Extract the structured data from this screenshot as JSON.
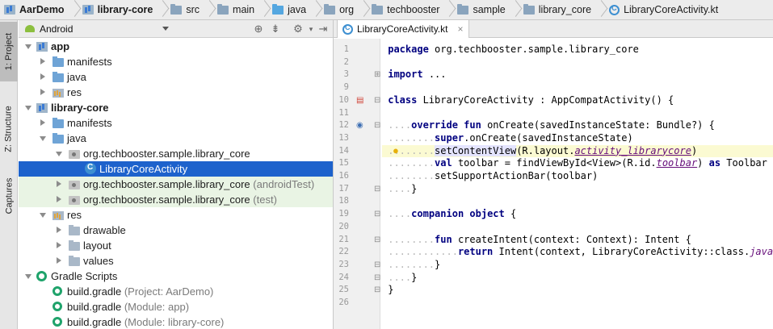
{
  "breadcrumbs": [
    {
      "label": "AarDemo",
      "icon": "module-icon",
      "bold": true
    },
    {
      "label": "library-core",
      "icon": "module-icon",
      "bold": true
    },
    {
      "label": "src",
      "icon": "folder-icon"
    },
    {
      "label": "main",
      "icon": "folder-icon"
    },
    {
      "label": "java",
      "icon": "folder-icon"
    },
    {
      "label": "org",
      "icon": "folder-icon"
    },
    {
      "label": "techbooster",
      "icon": "folder-icon"
    },
    {
      "label": "sample",
      "icon": "folder-icon"
    },
    {
      "label": "library_core",
      "icon": "folder-icon"
    },
    {
      "label": "LibraryCoreActivity.kt",
      "icon": "kotlin-class-icon"
    }
  ],
  "tool_strip": {
    "project_tab": "1: Project",
    "structure_tab": "Z: Structure",
    "captures_tab": "Captures"
  },
  "project_panel": {
    "view_mode": "Android",
    "tree": [
      {
        "label": "app",
        "bold": true
      },
      {
        "label": "manifests"
      },
      {
        "label": "java"
      },
      {
        "label": "res"
      },
      {
        "label": "library-core",
        "bold": true
      },
      {
        "label": "manifests"
      },
      {
        "label": "java"
      },
      {
        "label": "org.techbooster.sample.library_core"
      },
      {
        "label": "LibraryCoreActivity"
      },
      {
        "label": "org.techbooster.sample.library_core",
        "suffix": "(androidTest)"
      },
      {
        "label": "org.techbooster.sample.library_core",
        "suffix": "(test)"
      },
      {
        "label": "res"
      },
      {
        "label": "drawable"
      },
      {
        "label": "layout"
      },
      {
        "label": "values"
      },
      {
        "label": "Gradle Scripts"
      },
      {
        "label": "build.gradle",
        "suffix": "(Project: AarDemo)"
      },
      {
        "label": "build.gradle",
        "suffix": "(Module: app)"
      },
      {
        "label": "build.gradle",
        "suffix": "(Module: library-core)"
      }
    ]
  },
  "editor": {
    "tab_label": "LibraryCoreActivity.kt",
    "current_line": 14,
    "lines": [
      {
        "n": "1",
        "t": "package org.techbooster.sample.library_core"
      },
      {
        "n": "2",
        "t": ""
      },
      {
        "n": "3",
        "t": "import ..."
      },
      {
        "n": "9",
        "t": ""
      },
      {
        "n": "10",
        "t": "class LibraryCoreActivity : AppCompatActivity() {"
      },
      {
        "n": "11",
        "t": ""
      },
      {
        "n": "12",
        "t": "override fun onCreate(savedInstanceState: Bundle?) {"
      },
      {
        "n": "13",
        "t": "super.onCreate(savedInstanceState)"
      },
      {
        "n": "14",
        "t": "setContentView(R.layout.activity_librarycore)"
      },
      {
        "n": "15",
        "t": "val toolbar = findViewById<View>(R.id.toolbar) as Toolbar"
      },
      {
        "n": "16",
        "t": "setSupportActionBar(toolbar)"
      },
      {
        "n": "17",
        "t": "}"
      },
      {
        "n": "18",
        "t": ""
      },
      {
        "n": "19",
        "t": "companion object {"
      },
      {
        "n": "20",
        "t": ""
      },
      {
        "n": "21",
        "t": "fun createIntent(context: Context): Intent {"
      },
      {
        "n": "22",
        "t": "return Intent(context, LibraryCoreActivity::class.java)"
      },
      {
        "n": "23",
        "t": "}"
      },
      {
        "n": "24",
        "t": "}"
      },
      {
        "n": "25",
        "t": "}"
      },
      {
        "n": "26",
        "t": ""
      }
    ]
  }
}
